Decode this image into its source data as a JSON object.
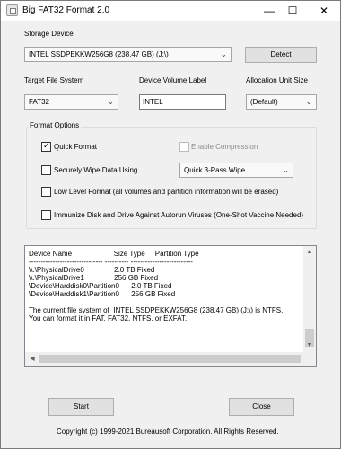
{
  "window": {
    "title": "Big FAT32 Format 2.0",
    "minimize_glyph": "—",
    "maximize_glyph": "☐",
    "close_glyph": "✕"
  },
  "storage": {
    "label": "Storage Device",
    "selected": "INTEL SSDPEKKW256G8 (238.47 GB) (J:\\)",
    "detect_label": "Detect"
  },
  "target_fs": {
    "label": "Target File System",
    "selected": "FAT32"
  },
  "volume_label": {
    "label": "Device Volume Label",
    "value": "INTEL"
  },
  "alloc_unit": {
    "label": "Allocation Unit Size",
    "selected": "(Default)"
  },
  "format_options": {
    "title": "Format Options",
    "quick_format": {
      "label": "Quick Format",
      "checked": true
    },
    "enable_compression": {
      "label": "Enable Compression",
      "checked": false,
      "disabled": true
    },
    "secure_wipe": {
      "label": "Securely Wipe Data Using",
      "checked": false
    },
    "wipe_method": {
      "selected": "Quick 3-Pass Wipe"
    },
    "low_level": {
      "label": "Low Level Format (all volumes and partition information will be erased)",
      "checked": false
    },
    "immunize": {
      "label": "Immunize Disk and Drive Against Autorun Viruses (One-Shot Vaccine Needed)",
      "checked": false
    }
  },
  "device_list": {
    "lines": [
      "Device Name                     Size Type     Partition Type",
      "------------------------------- ---------- --------------------------",
      "\\\\.\\PhysicalDrive0               2.0 TB Fixed",
      "\\\\.\\PhysicalDrive1               256 GB Fixed",
      "\\Device\\Harddisk0\\Partition0      2.0 TB Fixed",
      "\\Device\\Harddisk1\\Partition0      256 GB Fixed",
      "",
      "The current file system of  INTEL SSDPEKKW256G8 (238.47 GB) (J:\\) is NTFS.",
      "You can format it in FAT, FAT32, NTFS, or EXFAT."
    ]
  },
  "actions": {
    "start_label": "Start",
    "close_label": "Close"
  },
  "footer": {
    "copyright": "Copyright (c) 1999-2021 Bureausoft Corporation. All Rights Reserved."
  }
}
